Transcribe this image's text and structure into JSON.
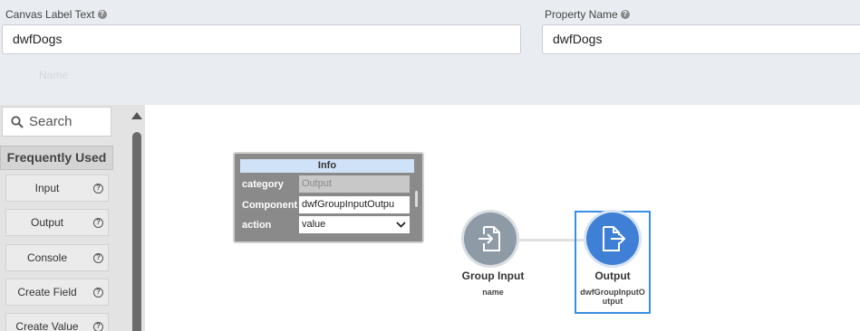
{
  "form": {
    "canvas_label": {
      "label": "Canvas Label Text",
      "value": "dwfDogs"
    },
    "property_name": {
      "label": "Property Name",
      "value": "dwfDogs"
    },
    "ghost_label": "Name"
  },
  "palette": {
    "search_placeholder": "Search",
    "section_title": "Frequently Used",
    "items": [
      {
        "label": "Input"
      },
      {
        "label": "Output"
      },
      {
        "label": "Console"
      },
      {
        "label": "Create Field"
      },
      {
        "label": "Create Value"
      }
    ]
  },
  "info_panel": {
    "title": "Info",
    "rows": [
      {
        "key": "category",
        "value": "Output"
      },
      {
        "key": "Component",
        "value": "dwfGroupInputOutpu"
      },
      {
        "key": "action",
        "value": "value"
      }
    ]
  },
  "nodes": [
    {
      "title": "Group Input",
      "subtitle": "name",
      "color": "#8e9aa5",
      "icon": "file-import-icon"
    },
    {
      "title": "Output",
      "subtitle": "dwfGroupInputO utput",
      "color": "#3f7fd6",
      "icon": "file-export-icon"
    }
  ],
  "colors": {
    "accent": "#3b8ee6",
    "info_header": "#cfe2f7"
  }
}
